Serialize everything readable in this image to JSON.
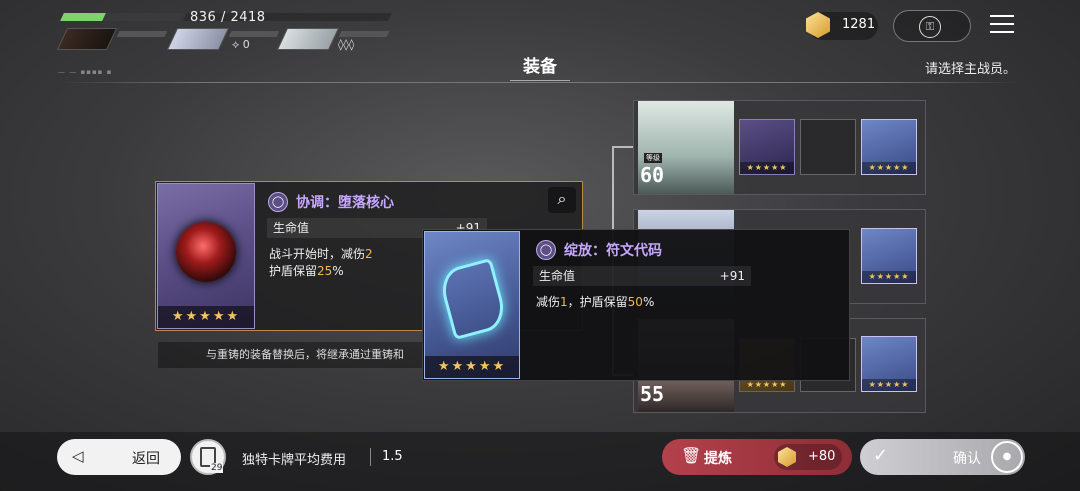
{
  "hud": {
    "hp_text": "836 / 2418",
    "hp_fraction": 0.35,
    "member2_value": "0",
    "member3_value": "◊◊◊"
  },
  "header": {
    "title": "装备",
    "hint": "请选择主战员。"
  },
  "topbar": {
    "currency_value": "1281",
    "lock_icon": "lock-icon",
    "menu_icon": "menu-icon"
  },
  "current_item": {
    "name": "协调：堕落核心",
    "stat_label": "生命值",
    "stat_value": "+91",
    "desc_line1_prefix": "战斗开始时，减伤",
    "desc_line1_value": "2",
    "desc_line2_prefix": "护盾保留",
    "desc_line2_value": "25",
    "desc_line2_suffix": "%",
    "stars": "★★★★★",
    "notice": "与重铸的装备替换后，将继承通过重铸和"
  },
  "new_item": {
    "name": "绽放：符文代码",
    "stat_label": "生命值",
    "stat_value": "+91",
    "desc_prefix": "减伤",
    "desc_value1": "1",
    "desc_mid": "，护盾保留",
    "desc_value2": "50",
    "desc_suffix": "%",
    "stars": "★★★★★"
  },
  "team": [
    {
      "level_label": "等级",
      "level": "60",
      "slot_stars": "★★★★★"
    },
    {
      "level_label": "",
      "level": "",
      "slot_stars": "★★★★★"
    },
    {
      "level_label": "",
      "level": "55",
      "slot_stars": "★★★★★"
    }
  ],
  "bottom": {
    "back_label": "返回",
    "card_count": "29",
    "avg_cost_label": "独特卡牌平均费用",
    "avg_cost_value": "1.5",
    "refine_label": "提炼",
    "refine_cost": "+80",
    "confirm_label": "确认"
  },
  "colors": {
    "accent_purple": "#c7a8ff",
    "highlight_gold": "#f2b84b",
    "refine_red": "#b4414c",
    "hp_green": "#7fd36b"
  }
}
